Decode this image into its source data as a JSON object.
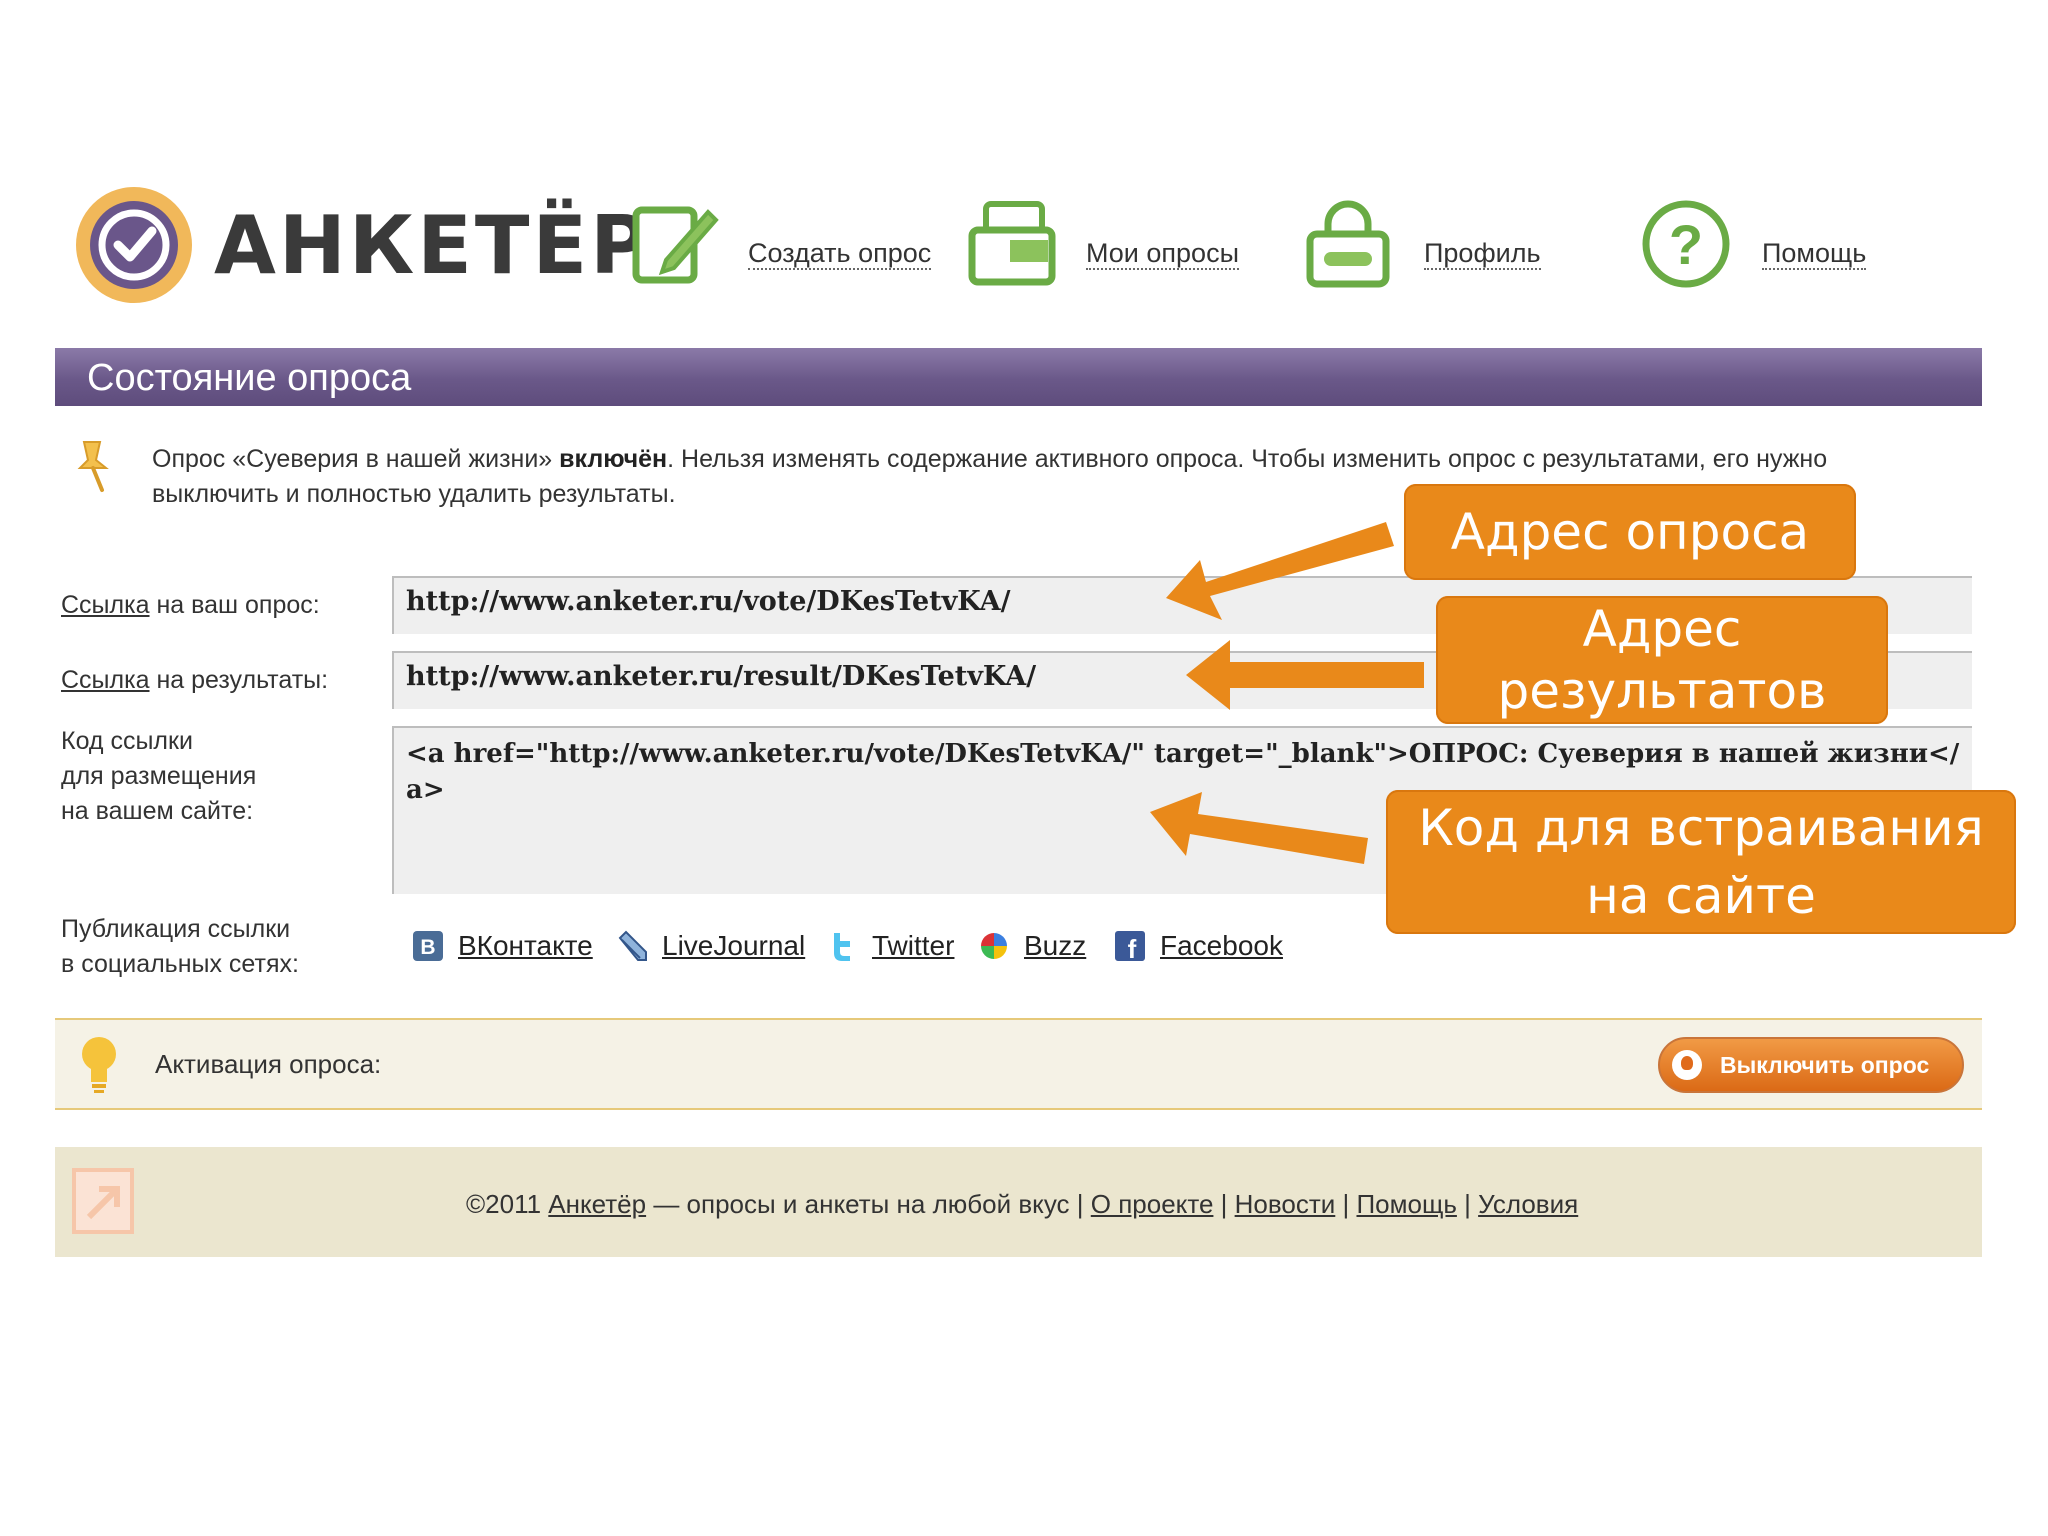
{
  "logo": {
    "text": "АНКЕТЁР"
  },
  "nav": {
    "create": "Создать опрос",
    "my": "Мои опросы",
    "profile": "Профиль",
    "help": "Помощь"
  },
  "title": "Состояние опроса",
  "notice": {
    "part1": "Опрос «Суеверия в нашей жизни» ",
    "bold": "включён",
    "part2": ". Нельзя изменять содержание активного опроса. Чтобы изменить опрос с результатами, его нужно выключить и полностью удалить результаты."
  },
  "links": {
    "vote_label_link": "Ссылка",
    "vote_label_rest": " на ваш опрос:",
    "vote_url": "http://www.anketer.ru/vote/DKesTetvKA/",
    "result_label_link": "Ссылка",
    "result_label_rest": " на результаты:",
    "result_url": "http://www.anketer.ru/result/DKesTetvKA/",
    "embed_label_1": "Код ссылки",
    "embed_label_2": "для размещения",
    "embed_label_3": "на вашем сайте:",
    "embed_code": "<a href=\"http://www.anketer.ru/vote/DKesTetvKA/\" target=\"_blank\">ОПРОС: Суеверия в нашей жизни</a>"
  },
  "social": {
    "label_1": "Публикация ссылки",
    "label_2": "в социальных сетях:",
    "vk": "ВКонтакте",
    "lj": "LiveJournal",
    "twitter": "Twitter",
    "buzz": "Buzz",
    "facebook": "Facebook"
  },
  "activation": {
    "label": "Активация опроса:",
    "button": "Выключить опрос"
  },
  "footer": {
    "copyright": "©2011 ",
    "site": "Анкетёр",
    "tagline": " — опросы и анкеты на любой вкус | ",
    "about": "О проекте",
    "sep": " | ",
    "news": "Новости",
    "help": "Помощь",
    "terms": "Условия"
  },
  "callouts": {
    "vote_address": "Адрес опроса",
    "results_line1": "Адрес",
    "results_line2": "результатов",
    "embed_line1": "Код для встраивания",
    "embed_line2": "на сайте"
  },
  "colors": {
    "accent_purple": "#6a5889",
    "callout_orange": "#e9891a",
    "icon_green": "#6aab45",
    "footer_bg": "#ebe6cf"
  }
}
